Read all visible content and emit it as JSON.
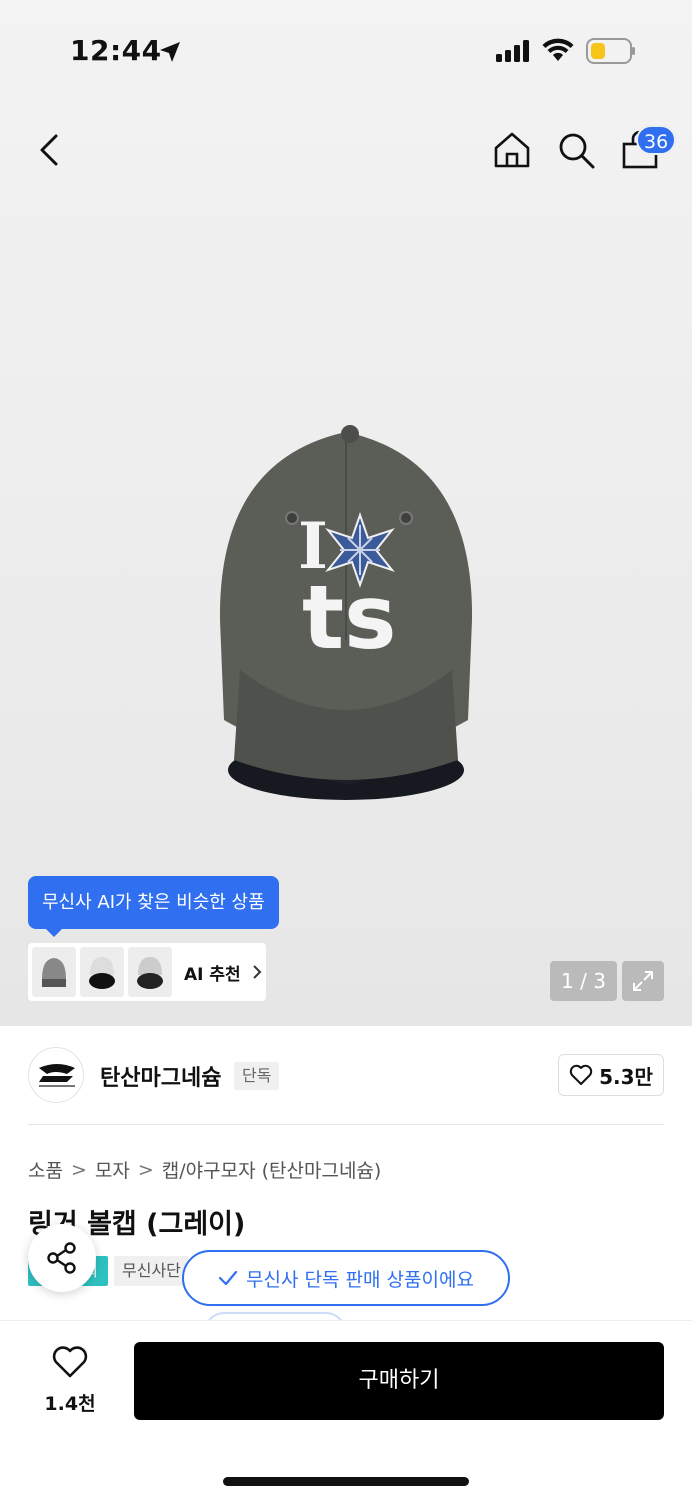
{
  "status": {
    "time": "12:44"
  },
  "nav": {
    "cart_count": "36"
  },
  "gallery": {
    "ai_tooltip": "무신사 AI가 찾은 비슷한 상품",
    "ai_reco_label": "AI 추천",
    "page_indicator": "1 / 3"
  },
  "brand": {
    "name": "탄산마그네슘",
    "exclusive_tag": "단독",
    "like_count": "5.3만"
  },
  "breadcrumb": [
    "소품",
    "모자",
    "캡/야구모자 (탄산마그네슘)"
  ],
  "product": {
    "title": "링거 볼캡 (그레이)",
    "tag_partial": "무신사단"
  },
  "toast": {
    "text": "무신사 단독 판매 상품이에요"
  },
  "bottom": {
    "like_count": "1.4천",
    "buy_label": "구매하기"
  },
  "colors": {
    "accent": "#2f6ff0",
    "tag_teal": "#2ec1c1"
  }
}
